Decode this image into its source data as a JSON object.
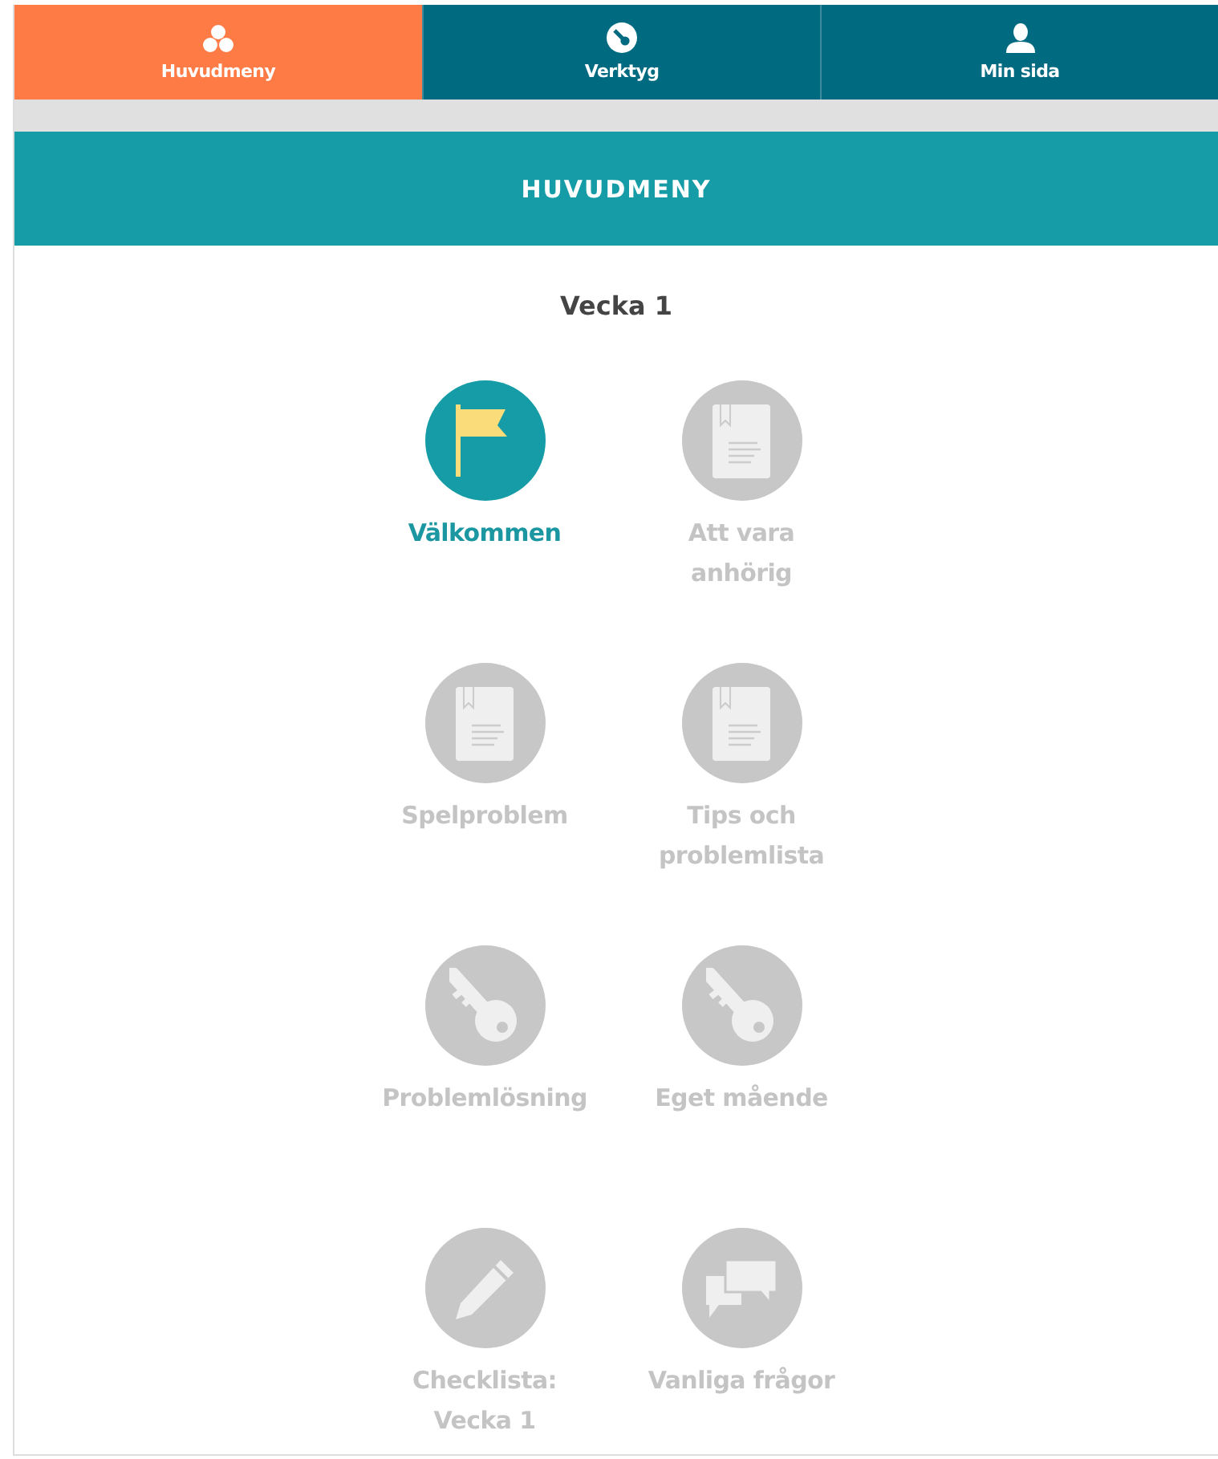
{
  "nav_tabs": [
    {
      "label": "Huvudmeny",
      "kind": "circles",
      "selected": true
    },
    {
      "label": "Verktyg",
      "kind": "key",
      "selected": false
    },
    {
      "label": "Min sida",
      "kind": "person",
      "selected": false
    }
  ],
  "header": {
    "title": "HUVUDMENY"
  },
  "week": {
    "title": "Vecka 1"
  },
  "items": [
    {
      "label": "Välkommen",
      "kind": "flag",
      "disabled": false
    },
    {
      "label": "Att vara anhörig",
      "kind": "book",
      "disabled": true
    },
    {
      "label": "Spelproblem",
      "kind": "book",
      "disabled": true
    },
    {
      "label": "Tips och problemlista",
      "kind": "book",
      "disabled": true
    },
    {
      "label": "Problemlösning",
      "kind": "key",
      "disabled": true
    },
    {
      "label": "Eget mående",
      "kind": "key",
      "disabled": true
    },
    {
      "label": "Checklista: Vecka 1",
      "kind": "pencil",
      "disabled": true
    },
    {
      "label": "Vanliga frågor",
      "kind": "chat",
      "disabled": true
    }
  ]
}
